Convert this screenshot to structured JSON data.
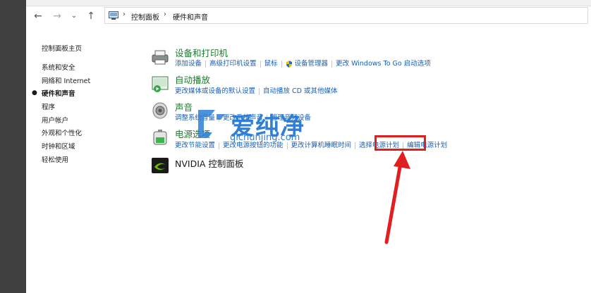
{
  "breadcrumb": {
    "items": [
      "控制面板",
      "硬件和声音"
    ]
  },
  "sidebar": {
    "items": [
      {
        "label": "控制面板主页"
      },
      {
        "label": "系统和安全"
      },
      {
        "label": "网络和 Internet"
      },
      {
        "label": "硬件和声音"
      },
      {
        "label": "程序"
      },
      {
        "label": "用户帐户"
      },
      {
        "label": "外观和个性化"
      },
      {
        "label": "时钟和区域"
      },
      {
        "label": "轻松使用"
      }
    ]
  },
  "categories": {
    "devices": {
      "title": "设备和打印机",
      "links": [
        "添加设备",
        "高级打印机设置",
        "鼠标",
        "设备管理器",
        "更改 Windows To Go 启动选项"
      ]
    },
    "autoplay": {
      "title": "自动播放",
      "links": [
        "更改媒体或设备的默认设置",
        "自动播放 CD 或其他媒体"
      ]
    },
    "sound": {
      "title": "声音",
      "links": [
        "调整系统音量",
        "更改系统声音",
        "管理音频设备"
      ]
    },
    "power": {
      "title": "电源选项",
      "links": [
        "更改节能设置",
        "更改电源按钮的功能",
        "更改计算机睡眠时间",
        "选择电源计划",
        "编辑电源计划"
      ]
    },
    "nvidia": {
      "title": "NVIDIA 控制面板"
    }
  },
  "watermark": {
    "brand": "爱纯净",
    "url": "qichunjing.com"
  },
  "colors": {
    "title_green": "#1e7b2e",
    "link_blue": "#1a5fb4",
    "highlight_red": "#e02020"
  }
}
